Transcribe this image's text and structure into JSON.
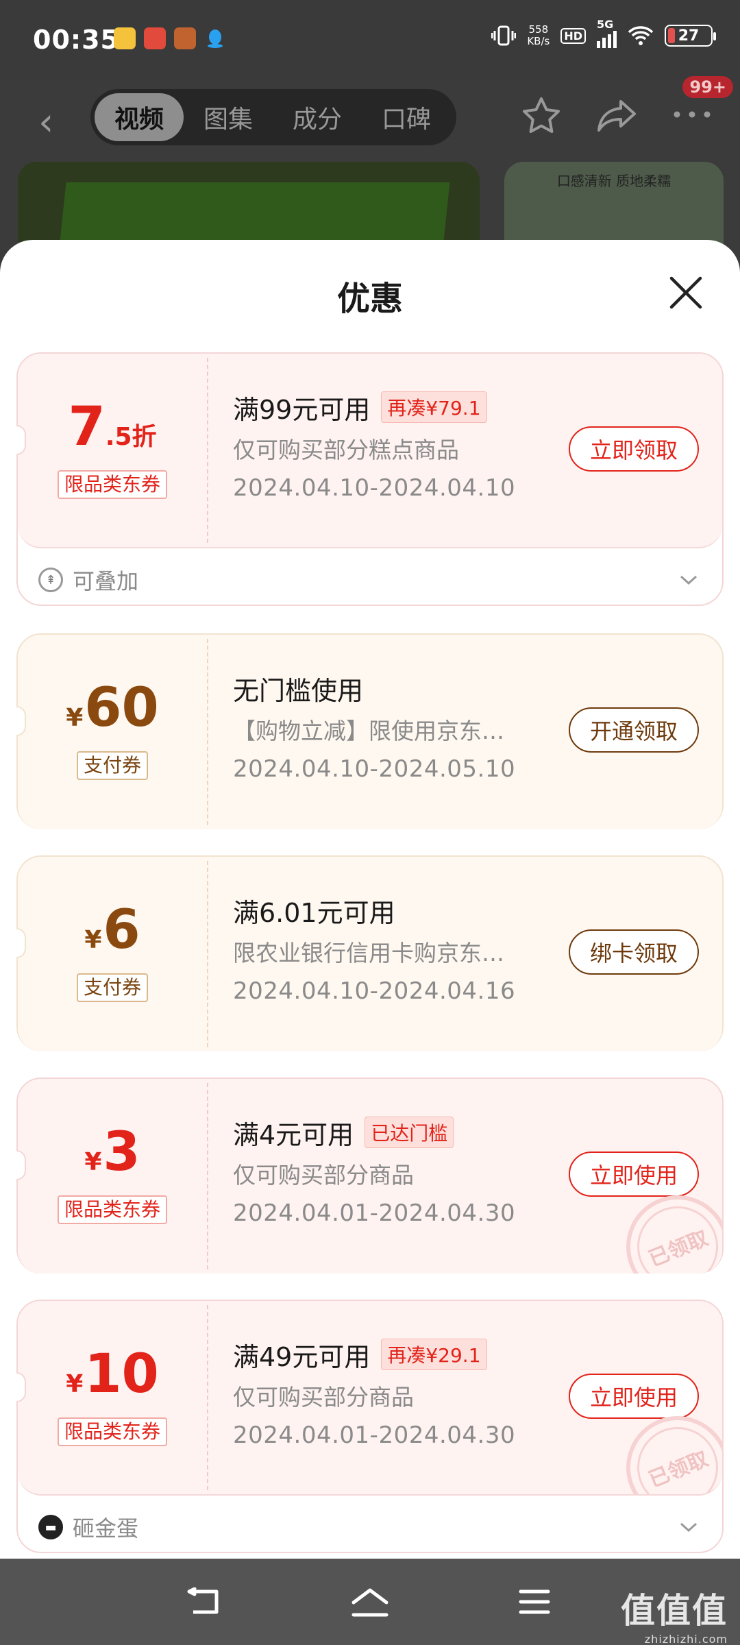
{
  "status_bar": {
    "time": "00:35",
    "net_speed_value": "558",
    "net_speed_unit": "KB/s",
    "hd": "HD",
    "network": "5G",
    "battery": "27"
  },
  "nav": {
    "tabs": [
      "视频",
      "图集",
      "成分",
      "口碑"
    ],
    "badge": "99+"
  },
  "product_thumb_caption": "口感清新 质地柔糯",
  "sheet": {
    "title": "优惠",
    "coupons": [
      {
        "amount_main": "7",
        "amount_suffix": ".5折",
        "type": "限品类东券",
        "condition": "满99元可用",
        "pill": "再凑¥79.1",
        "desc": "仅可购买部分糕点商品",
        "date": "2024.04.10-2024.04.10",
        "button": "立即领取",
        "footer": "可叠加"
      },
      {
        "yen": "¥",
        "amount_main": "60",
        "type": "支付券",
        "condition": "无门槛使用",
        "desc": "【购物立减】限使用京东…",
        "date": "2024.04.10-2024.05.10",
        "button": "开通领取"
      },
      {
        "yen": "¥",
        "amount_main": "6",
        "type": "支付券",
        "condition": "满6.01元可用",
        "desc": "限农业银行信用卡购京东…",
        "date": "2024.04.10-2024.04.16",
        "button": "绑卡领取"
      },
      {
        "yen": "¥",
        "amount_main": "3",
        "type": "限品类东券",
        "condition": "满4元可用",
        "pill": "已达门槛",
        "desc": "仅可购买部分商品",
        "date": "2024.04.01-2024.04.30",
        "button": "立即使用",
        "stamp": "已领取"
      },
      {
        "yen": "¥",
        "amount_main": "10",
        "type": "限品类东券",
        "condition": "满49元可用",
        "pill": "再凑¥29.1",
        "desc": "仅可购买部分商品",
        "date": "2024.04.01-2024.04.30",
        "button": "立即使用",
        "stamp": "已领取",
        "footer": "砸金蛋"
      }
    ]
  },
  "watermark": {
    "main": "值值值",
    "sub": "zhizhizhi.com"
  }
}
